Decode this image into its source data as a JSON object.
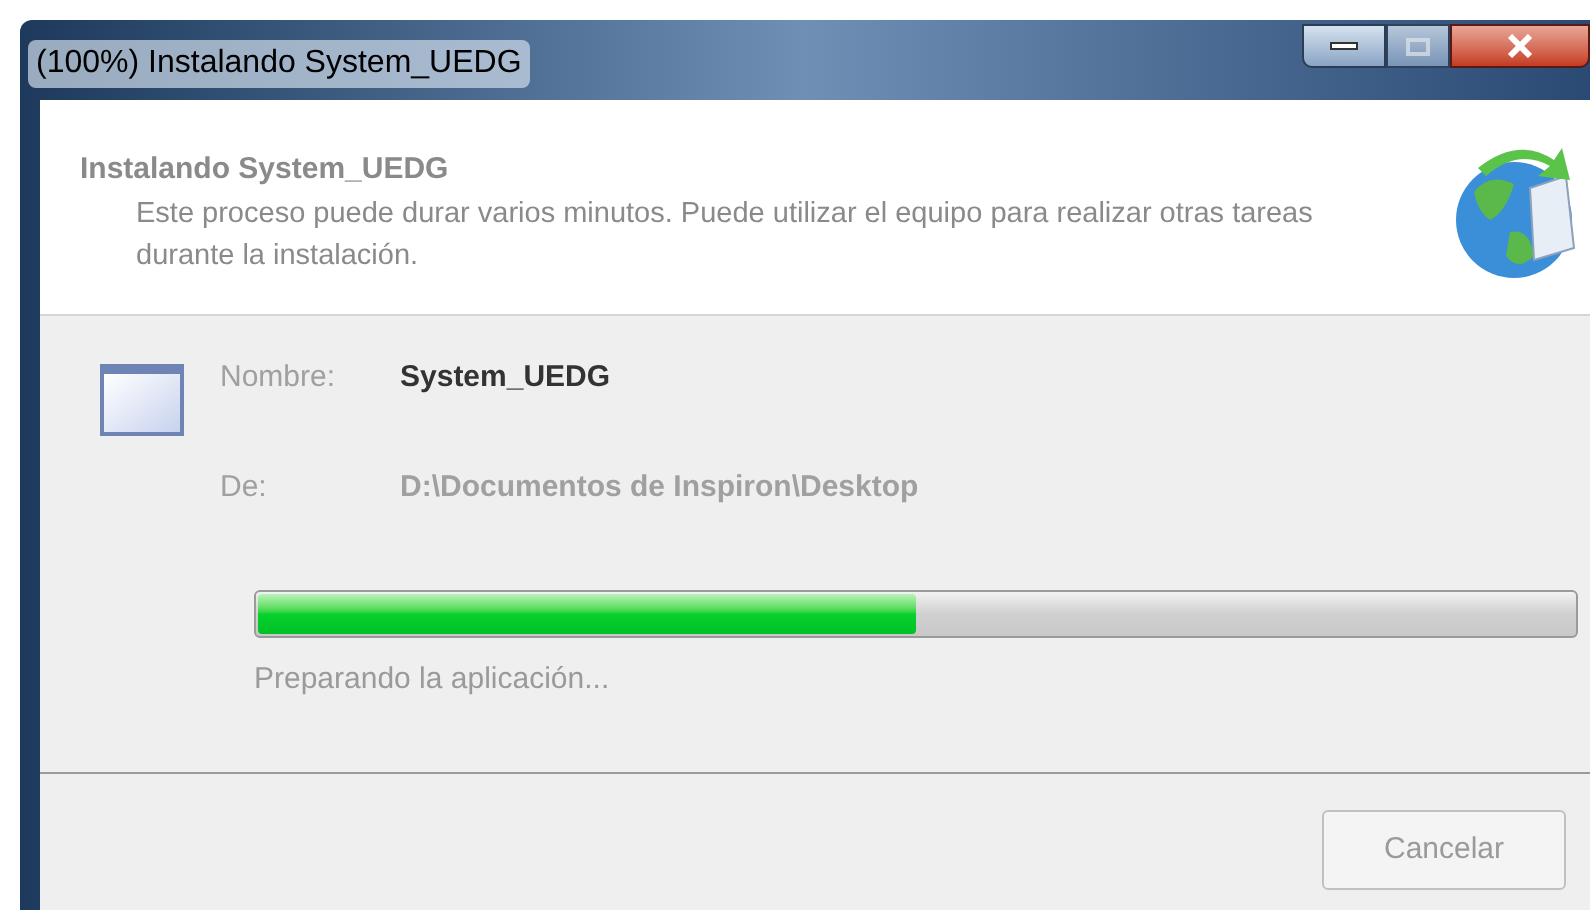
{
  "window": {
    "title": "(100%) Instalando System_UEDG"
  },
  "header": {
    "title": "Instalando System_UEDG",
    "description": "Este proceso puede durar varios minutos. Puede utilizar el equipo para realizar otras tareas durante la instalación."
  },
  "fields": [
    {
      "label": "Nombre:",
      "value": "System_UEDG",
      "emphasis": true
    },
    {
      "label": "De:",
      "value": "D:\\Documentos de Inspiron\\Desktop",
      "emphasis": false
    }
  ],
  "progress": {
    "level": 0.5,
    "status": "Preparando la aplicación..."
  },
  "buttons": [
    {
      "label": "Cancelar",
      "disabled": true
    }
  ]
}
